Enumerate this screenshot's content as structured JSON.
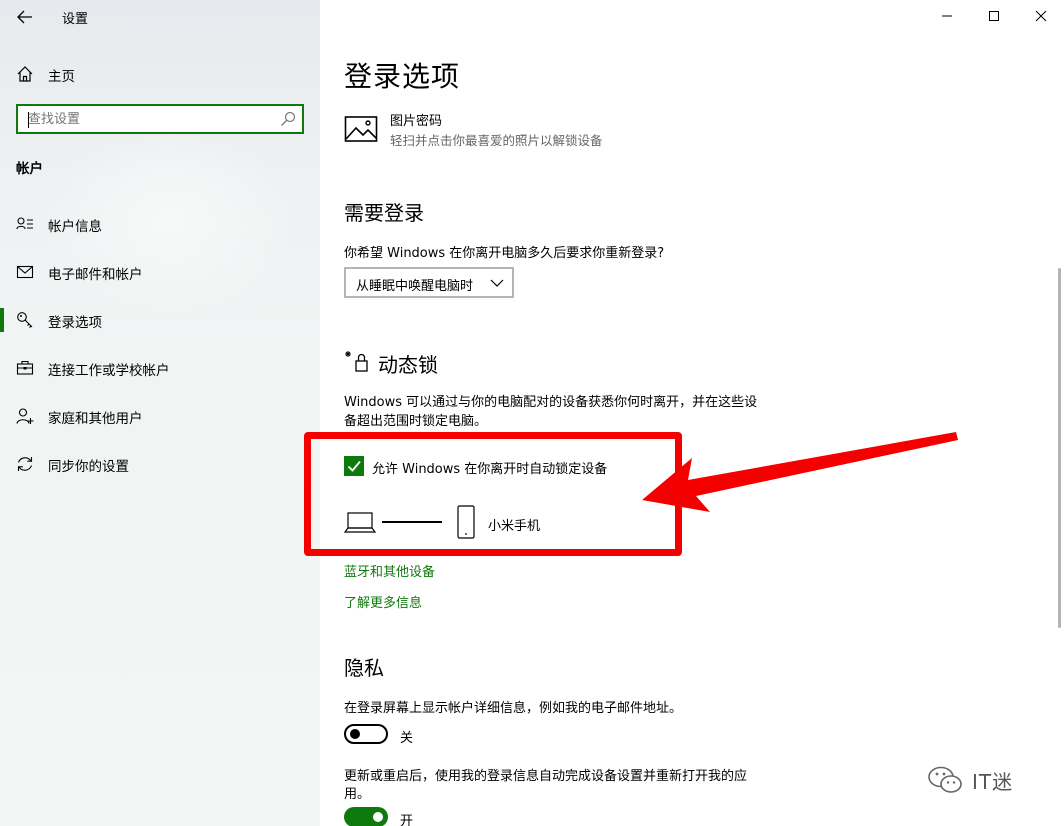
{
  "window": {
    "title": "设置",
    "minimize_icon": "minimize-icon",
    "maximize_icon": "maximize-icon",
    "close_icon": "close-icon"
  },
  "sidebar": {
    "home_label": "主页",
    "search_placeholder": "查找设置",
    "section_title": "帐户",
    "items": [
      {
        "label": "帐户信息",
        "icon": "user-info-icon"
      },
      {
        "label": "电子邮件和帐户",
        "icon": "mail-icon"
      },
      {
        "label": "登录选项",
        "icon": "key-icon",
        "active": true
      },
      {
        "label": "连接工作或学校帐户",
        "icon": "briefcase-icon"
      },
      {
        "label": "家庭和其他用户",
        "icon": "person-add-icon"
      },
      {
        "label": "同步你的设置",
        "icon": "sync-icon"
      }
    ]
  },
  "main": {
    "page_title": "登录选项",
    "picture_password": {
      "name": "图片密码",
      "desc": "轻扫并点击你最喜爱的照片以解锁设备"
    },
    "require_signin": {
      "heading": "需要登录",
      "question": "你希望 Windows 在你离开电脑多久后要求你重新登录?",
      "selected": "从睡眠中唤醒电脑时"
    },
    "dynamic_lock": {
      "heading": "动态锁",
      "desc_line1": "Windows 可以通过与你的电脑配对的设备获悉你何时离开，并在这些设",
      "desc_line2": "备超出范围时锁定电脑。",
      "checkbox_label": "允许 Windows 在你离开时自动锁定设备",
      "checkbox_checked": true,
      "paired_device": "小米手机",
      "link_bluetooth": "蓝牙和其他设备",
      "link_more": "了解更多信息"
    },
    "privacy": {
      "heading": "隐私",
      "setting1_desc": "在登录屏幕上显示帐户详细信息，例如我的电子邮件地址。",
      "setting1_state": "关",
      "setting2_desc_line1": "更新或重启后，使用我的登录信息自动完成设备设置并重新打开我的应",
      "setting2_desc_line2": "用。",
      "setting2_state": "开"
    }
  },
  "watermark": {
    "text": "IT迷"
  },
  "colors": {
    "accent": "#0e7a0d",
    "highlight": "#f40000"
  }
}
